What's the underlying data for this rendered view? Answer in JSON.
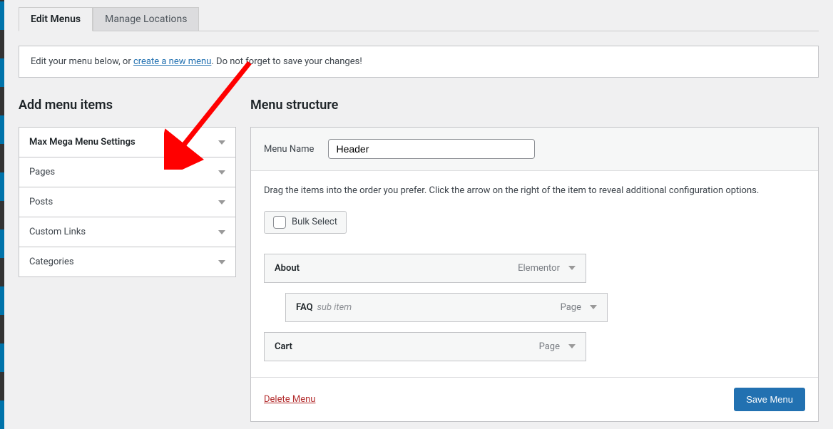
{
  "tabs": {
    "edit": "Edit Menus",
    "locations": "Manage Locations"
  },
  "notice": {
    "prefix": "Edit your menu below, or ",
    "link": "create a new menu",
    "suffix": ". Do not forget to save your changes!"
  },
  "left": {
    "heading": "Add menu items",
    "items": [
      "Max Mega Menu Settings",
      "Pages",
      "Posts",
      "Custom Links",
      "Categories"
    ]
  },
  "right": {
    "heading": "Menu structure",
    "menu_name_label": "Menu Name",
    "menu_name_value": "Header",
    "instructions": "Drag the items into the order you prefer. Click the arrow on the right of the item to reveal additional configuration options.",
    "bulk_select": "Bulk Select",
    "items": [
      {
        "title": "About",
        "sub": "",
        "type": "Elementor"
      },
      {
        "title": "FAQ",
        "sub": "sub item",
        "type": "Page"
      },
      {
        "title": "Cart",
        "sub": "",
        "type": "Page"
      }
    ],
    "delete": "Delete Menu",
    "save": "Save Menu"
  }
}
